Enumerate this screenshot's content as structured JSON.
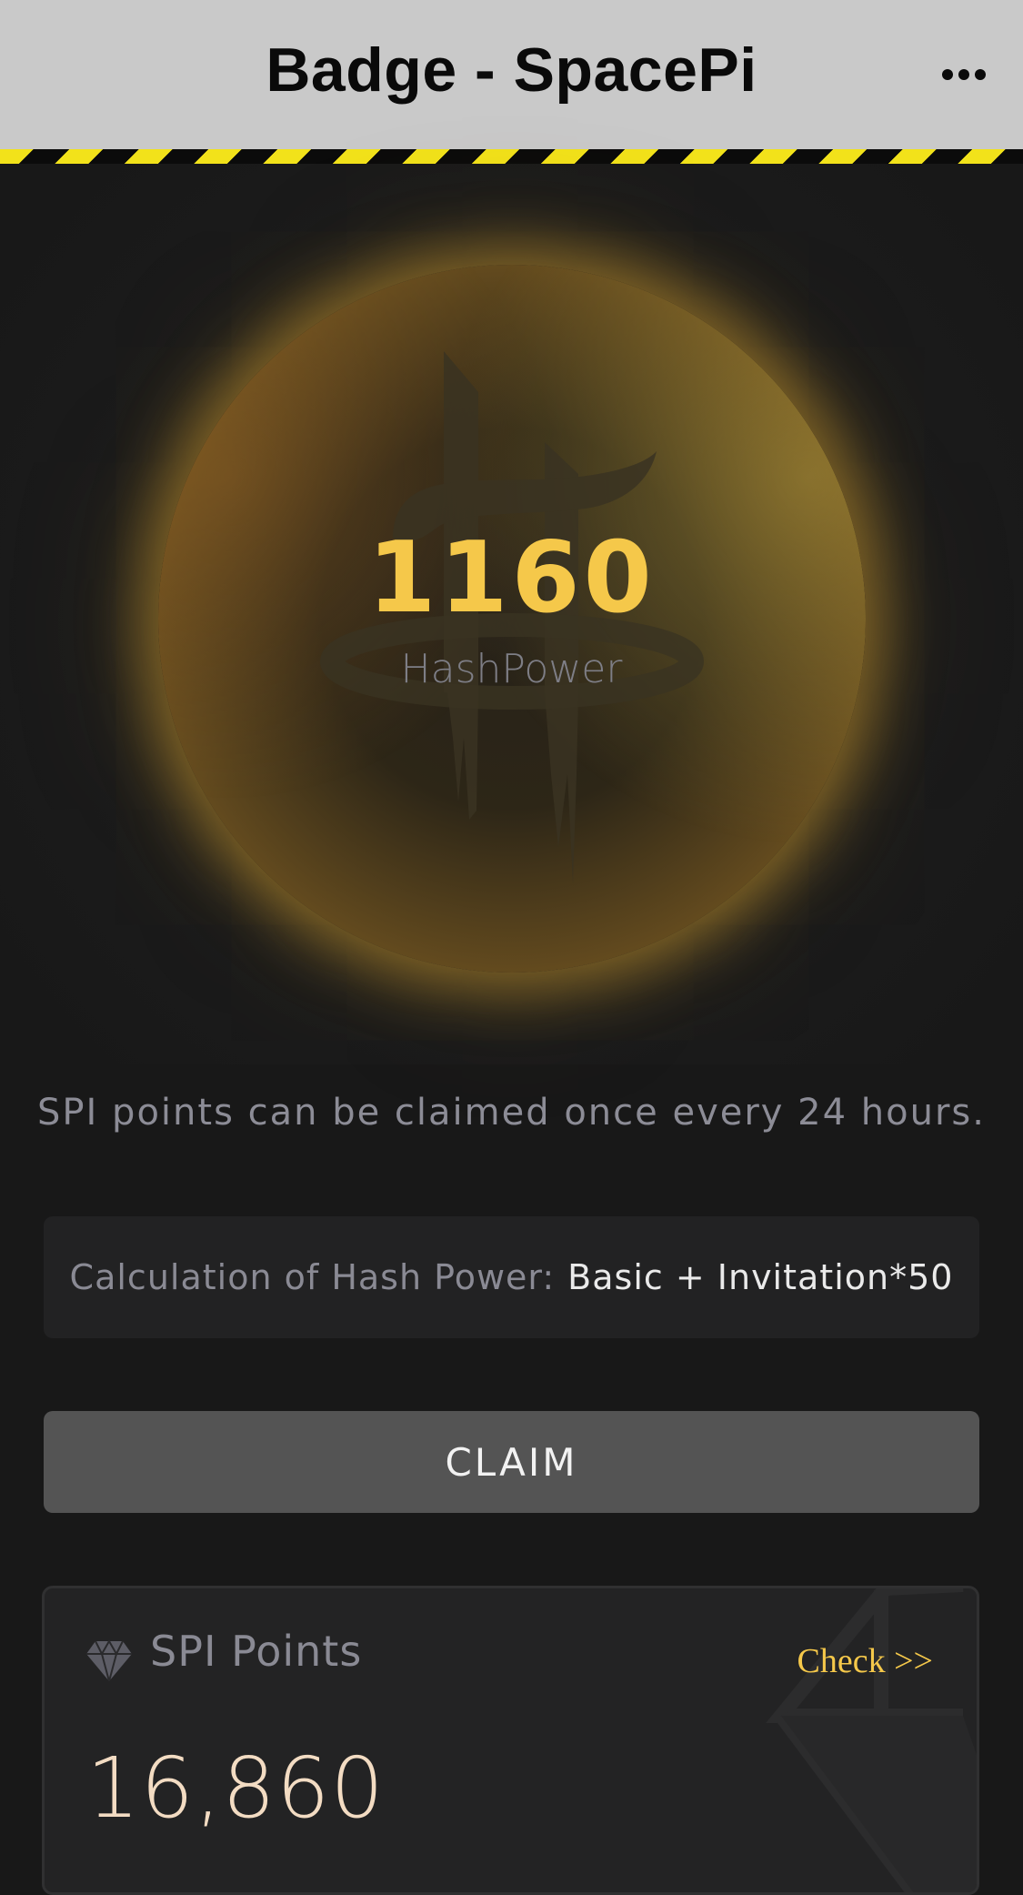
{
  "header": {
    "title": "Badge - SpacePi",
    "more_icon": "more-horizontal-icon"
  },
  "hero": {
    "hash_value": "1160",
    "hash_label": "HashPower",
    "accent_color": "#f5c84a",
    "logo_icon": "spacepi-logo"
  },
  "claim_note": "SPI points can be claimed once every 24 hours.",
  "calculation": {
    "label": "Calculation of Hash Power:",
    "formula": "Basic + Invitation*50"
  },
  "claim_button": {
    "label": "CLAIM"
  },
  "points_card": {
    "icon": "diamond-icon",
    "title": "SPI Points",
    "link": "Check >>",
    "value": "16,860"
  }
}
